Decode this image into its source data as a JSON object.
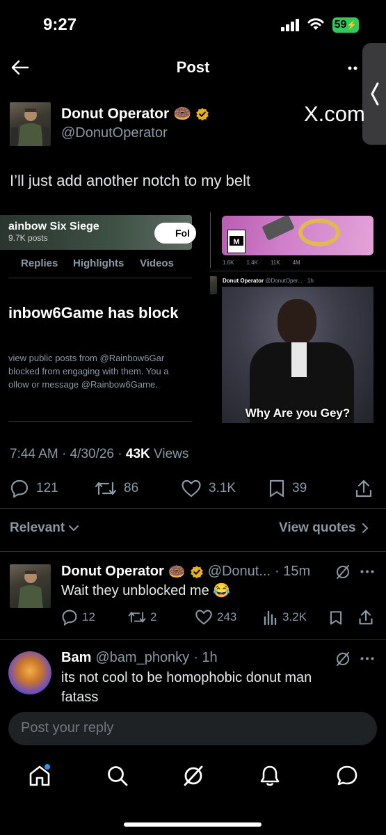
{
  "status": {
    "time": "9:27",
    "battery": "59"
  },
  "header": {
    "title": "Post",
    "back_icon": "arrow-left-icon",
    "more_icon": "more-icon"
  },
  "author": {
    "name": "Donut Operator",
    "handle": "@DonutOperator",
    "emoji": "🍩",
    "verified_color": "#e8b21e",
    "brand": "X.com"
  },
  "post": {
    "text": "I’ll just add another notch to my belt"
  },
  "embed_left": {
    "profile_title": "ainbow Six Siege",
    "profile_posts": "9.7K posts",
    "follow_label": "Fol",
    "tabs": [
      "Replies",
      "Highlights",
      "Videos"
    ],
    "blocked_title": "inbow6Game has block",
    "blocked_lines": [
      "view public posts from @Rainbow6Gar",
      "blocked from engaging with them. You a",
      "ollow or message @Rainbow6Game."
    ]
  },
  "embed_right": {
    "stats": [
      "1.6K",
      "1.4K",
      "11K",
      "4M"
    ],
    "author": "Donut Operator",
    "handle": "@DonutOper... · 1h",
    "caption": "Why Are you Gey?"
  },
  "meta": {
    "time": "7:44 AM",
    "date": "4/30/26",
    "views_count": "43K",
    "views_label": "Views"
  },
  "actions": {
    "replies": "121",
    "reposts": "86",
    "likes": "3.1K",
    "bookmarks": "39"
  },
  "sort": {
    "label": "Relevant",
    "view_quotes": "View quotes"
  },
  "replies": [
    {
      "name": "Donut Operator",
      "emoji": "🍩",
      "handle": "@Donut...",
      "time": "· 15m",
      "text": "Wait they unblocked me 😂",
      "stats": {
        "replies": "12",
        "reposts": "2",
        "likes": "243",
        "views": "3.2K"
      }
    },
    {
      "name": "Bam",
      "handle": "@bam_phonky",
      "time": "· 1h",
      "text_lines": [
        "its not cool to be homophobic donut man",
        "fatass"
      ]
    }
  ],
  "composer": {
    "placeholder": "Post your reply"
  },
  "colors": {
    "background": "#000000",
    "secondary_text": "#8b98a5",
    "accent_blue": "#1d9bf0"
  }
}
